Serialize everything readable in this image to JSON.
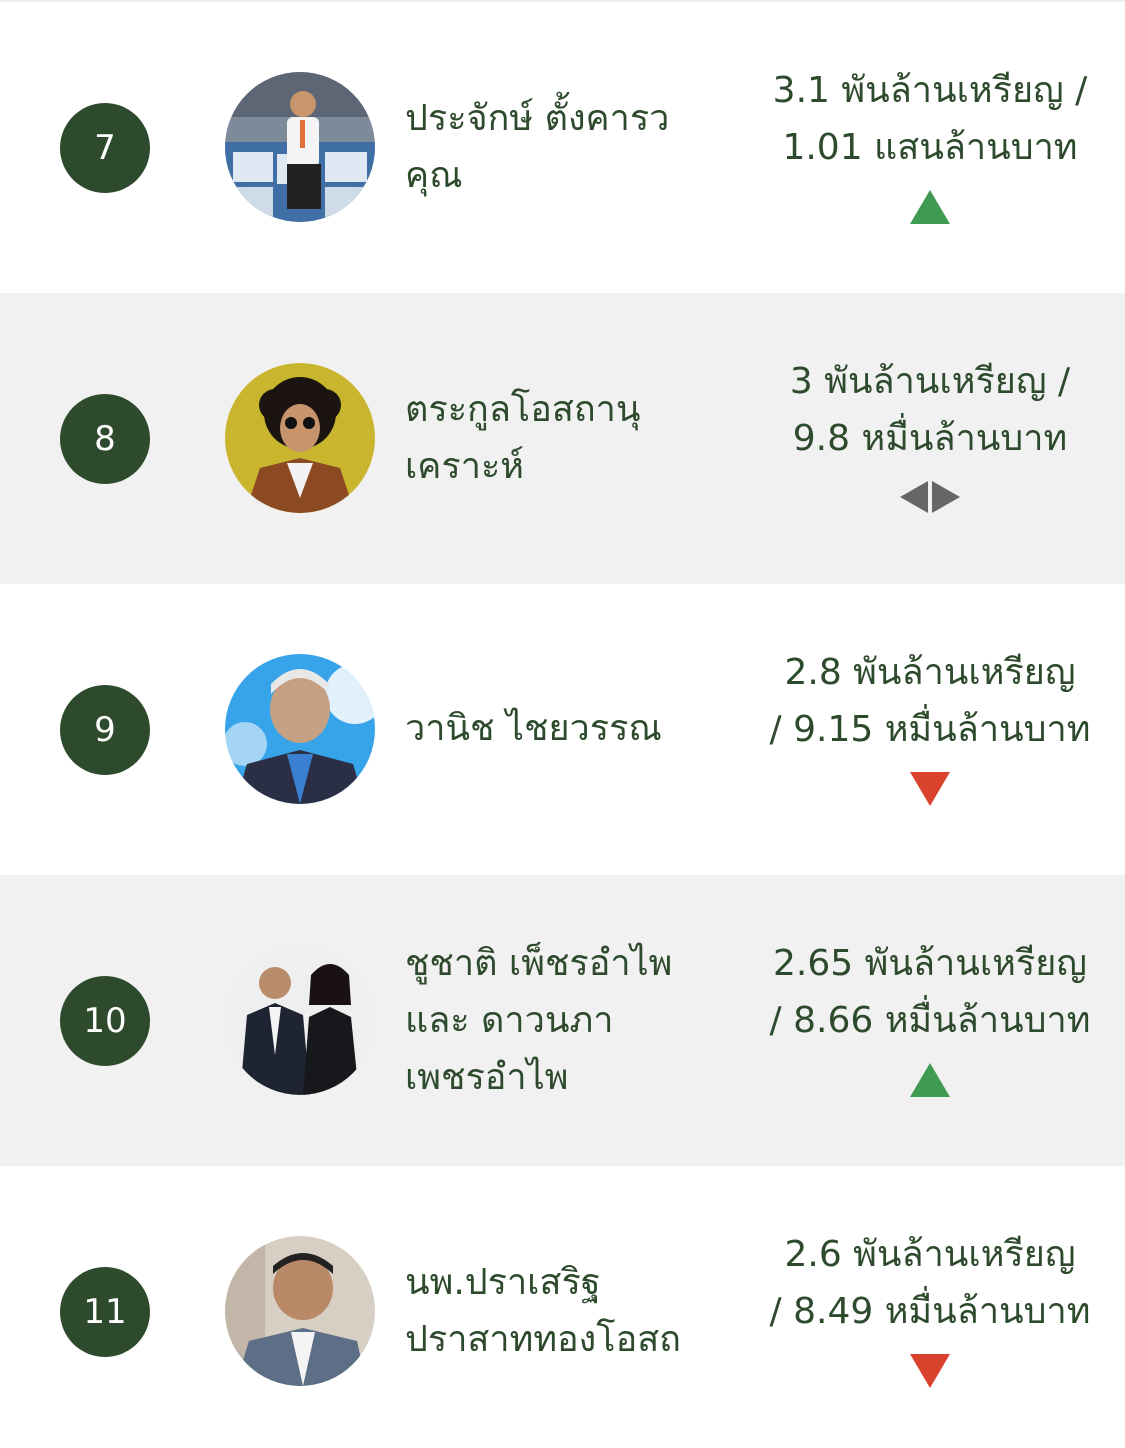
{
  "colors": {
    "rank_bg": "#2e4a2c",
    "text": "#2e4a2c",
    "up": "#3f9a52",
    "down": "#d9432e",
    "same": "#666666",
    "alt_row_bg": "#f1f1f1"
  },
  "rows": [
    {
      "rank": "7",
      "name_lines": [
        "ประจักษ์ ตั้งคารว",
        "คุณ"
      ],
      "value_lines": [
        "3.1 พันล้านเหรียญ /",
        "1.01 แสนล้านบาท"
      ],
      "trend": "up",
      "trend_icon": "triangle-up-icon"
    },
    {
      "rank": "8",
      "name_lines": [
        "ตระกูลโอสถานุ",
        "เคราะห์"
      ],
      "value_lines": [
        "3 พันล้านเหรียญ /",
        "9.8 หมื่นล้านบาท"
      ],
      "trend": "unchanged",
      "trend_icon": "left-right-arrow-icon"
    },
    {
      "rank": "9",
      "name_lines": [
        "วานิช ไชยวรรณ"
      ],
      "value_lines": [
        "2.8 พันล้านเหรียญ",
        "/ 9.15 หมื่นล้านบาท"
      ],
      "trend": "down",
      "trend_icon": "triangle-down-icon"
    },
    {
      "rank": "10",
      "name_lines": [
        "ชูชาติ เพ็ชรอำไพ",
        "และ ดาวนภา",
        "เพชรอำไพ"
      ],
      "value_lines": [
        "2.65 พันล้านเหรียญ",
        "/ 8.66 หมื่นล้านบาท"
      ],
      "trend": "up",
      "trend_icon": "triangle-up-icon"
    },
    {
      "rank": "11",
      "name_lines": [
        "นพ.ปราเสริฐ",
        "ปราสาททองโอสถ"
      ],
      "value_lines": [
        "2.6 พันล้านเหรียญ",
        "/ 8.49 หมื่นล้านบาท"
      ],
      "trend": "down",
      "trend_icon": "triangle-down-icon"
    }
  ]
}
